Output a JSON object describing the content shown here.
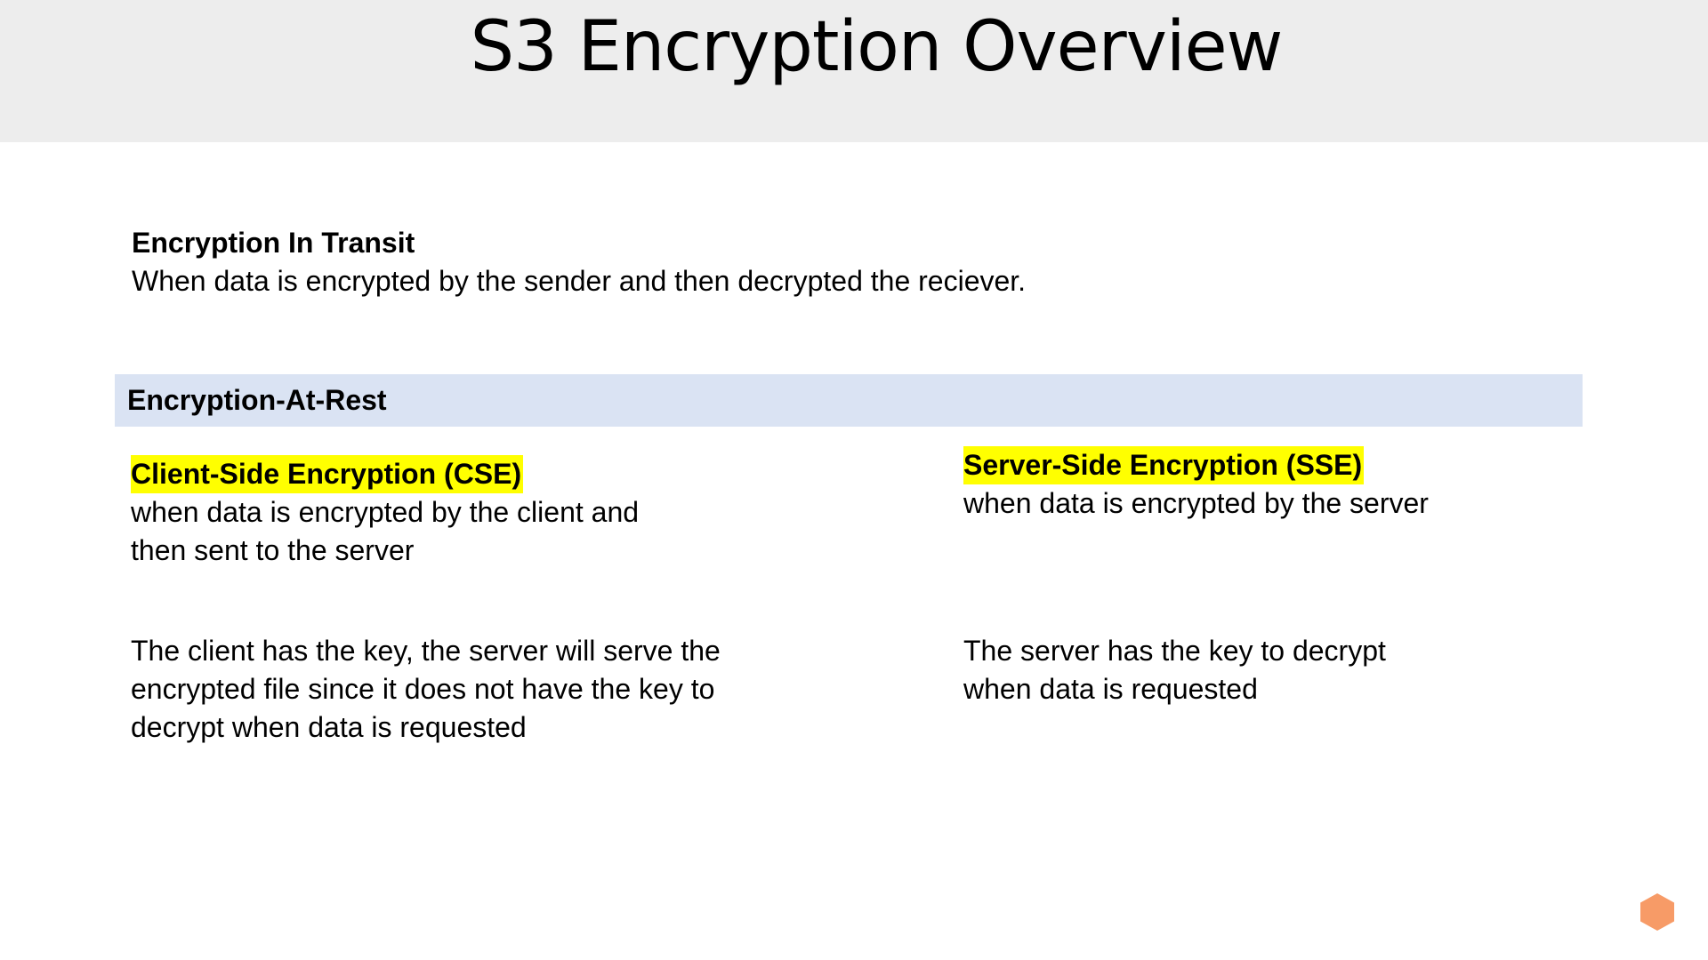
{
  "slide": {
    "title": "S3 Encryption Overview"
  },
  "transit": {
    "heading": "Encryption In Transit",
    "lines": [
      "When data is encrypted by the sender and then decrypted the reciever."
    ]
  },
  "rest": {
    "heading": "Encryption-At-Rest"
  },
  "cse": {
    "heading": "Client-Side Encryption  (CSE)",
    "lines": [
      "when data is encrypted by the client and",
      "then sent to the server"
    ],
    "note_lines": [
      "The client has the key, the server will serve the",
      "encrypted file since it does not have the key to",
      "decrypt when data is requested"
    ]
  },
  "sse": {
    "heading": "Server-Side Encryption (SSE)",
    "lines": [
      "when data is encrypted by the server"
    ],
    "note_lines": [
      "The server has the key to decrypt",
      "when data is requested"
    ]
  },
  "colors": {
    "title_band": "#ededed",
    "rest_band": "#dae3f3",
    "highlight": "#ffff00",
    "logo": "#f79b67"
  },
  "logo": {
    "icon": "hexagon-logo-icon"
  }
}
